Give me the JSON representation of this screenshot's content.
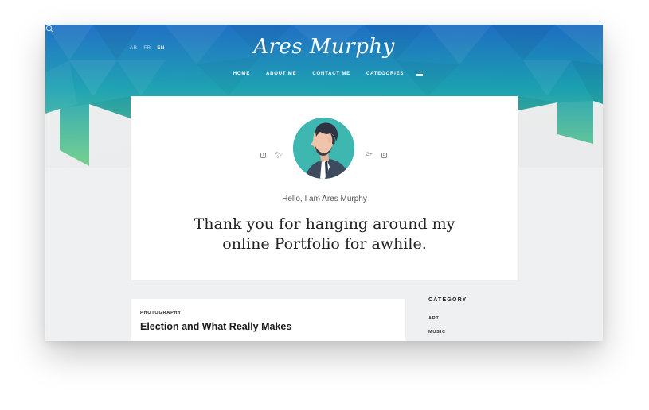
{
  "site": {
    "brand": "Ares Murphy"
  },
  "languages": [
    {
      "label": "AR",
      "active": false
    },
    {
      "label": "FR",
      "active": false
    },
    {
      "label": "EN",
      "active": true
    }
  ],
  "nav": {
    "items": [
      "HOME",
      "ABOUT ME",
      "CONTACT ME",
      "CATEGORIES"
    ],
    "menu_icon": "hamburger-icon",
    "search_icon": "search-icon"
  },
  "intro": {
    "hello": "Hello, I am Ares Murphy",
    "tagline_line1": "Thank you for hanging around my",
    "tagline_line2": "online Portfolio for awhile.",
    "social_icons": [
      "facebook-icon",
      "twitter-icon",
      "google-plus-icon",
      "instagram-icon"
    ]
  },
  "post": {
    "category": "PHOTOGRAPHY",
    "title": "Election and What Really Makes"
  },
  "sidebar": {
    "heading": "CATEGORY",
    "items": [
      "ART",
      "MUSIC"
    ]
  },
  "colors": {
    "hero_top": "#1a6fc4",
    "hero_bottom": "#6fd08a",
    "avatar_bg": "#3fb7b1",
    "page_bg": "#eef0f1"
  }
}
